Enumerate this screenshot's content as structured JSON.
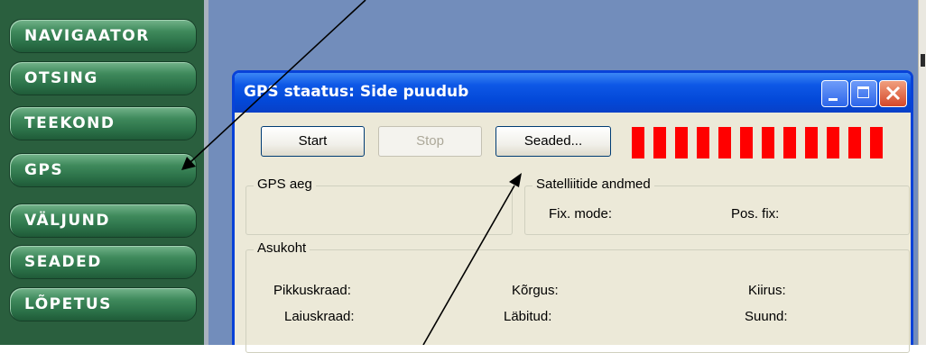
{
  "nav": {
    "items": [
      {
        "label": "NAVIGAATOR"
      },
      {
        "label": "OTSING"
      },
      {
        "label": "TEEKOND"
      },
      {
        "label": "GPS"
      },
      {
        "label": "VÄLJUND"
      },
      {
        "label": "SEADED"
      },
      {
        "label": "LÕPETUS"
      }
    ]
  },
  "dialog": {
    "title": "GPS staatus: Side puudub",
    "buttons": {
      "start": "Start",
      "stop": "Stop",
      "settings": "Seaded..."
    },
    "signal": {
      "bar_count": 12,
      "color": "#ff0000"
    },
    "gps_time": {
      "label": "GPS aeg"
    },
    "satellites": {
      "label": "Satelliitide andmed",
      "fix_mode": "Fix. mode:",
      "pos_fix": "Pos. fix:"
    },
    "location": {
      "label": "Asukoht",
      "longitude": "Pikkuskraad:",
      "latitude": "Laiuskraad:",
      "altitude": "Kõrgus:",
      "traveled": "Läbitud:",
      "speed": "Kiirus:",
      "heading": "Suund:"
    }
  },
  "colors": {
    "nav_green": "#2c7249",
    "titlebar_blue": "#0348d8",
    "desktop_blue": "#728dbb"
  },
  "annotations": {
    "arrow_color": "#000000"
  }
}
